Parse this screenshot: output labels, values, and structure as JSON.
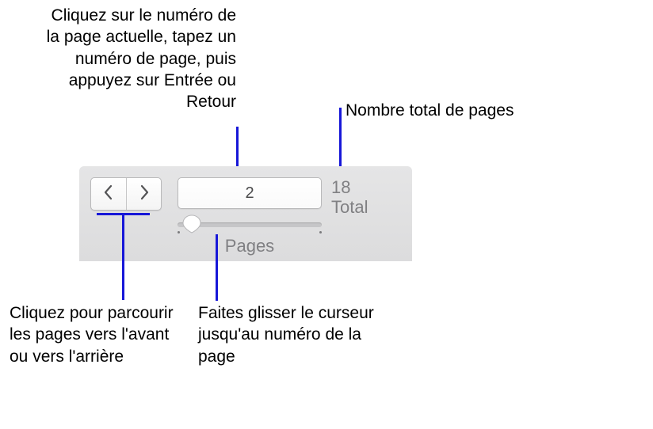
{
  "callouts": {
    "pageInput": "Cliquez sur le numéro de la page actuelle, tapez un numéro de page, puis appuyez sur Entrée ou Retour",
    "totalPages": "Nombre total de pages",
    "navButtons": "Cliquez pour parcourir les pages vers l'avant ou vers l'arrière",
    "slider": "Faites glisser le curseur jusqu'au numéro de la page"
  },
  "panel": {
    "currentPage": "2",
    "totalCount": "18",
    "totalLabel": "Total",
    "pagesLabel": "Pages"
  }
}
